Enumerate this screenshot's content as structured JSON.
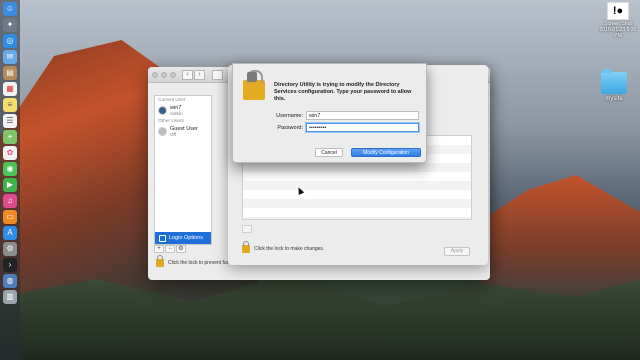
{
  "desktop": {
    "screenshot_label_1": "Screen Shot",
    "screenshot_label_2": "2018-01-23 6:30 PM",
    "folder_label": "mysite"
  },
  "dock": {
    "icons": [
      "finder-icon",
      "launchpad-icon",
      "safari-icon",
      "mail-icon",
      "contacts-icon",
      "calendar-icon",
      "notes-icon",
      "reminders-icon",
      "maps-icon",
      "photos-icon",
      "messages-icon",
      "facetime-icon",
      "itunes-icon",
      "ibooks-icon",
      "app-store-icon",
      "system-preferences-icon",
      "terminal-icon",
      "network-icon",
      "trash-icon"
    ]
  },
  "users_window": {
    "current_user_header": "Current User",
    "current_user_name": "win7",
    "current_user_role": "Admin",
    "other_users_header": "Other Users",
    "guest_name": "Guest User",
    "guest_role": "Off",
    "login_options": "Login Options",
    "add_label": "+",
    "remove_label": "−",
    "lock_text": "Click the lock to prevent further changes."
  },
  "directory_utility": {
    "lock_text": "Click the lock to make changes.",
    "apply_label": "Apply"
  },
  "auth_sheet": {
    "message": "Directory Utility is trying to modify the Directory Services configuration. Type your password to allow this.",
    "username_label": "Username:",
    "username_value": "win7",
    "password_label": "Password:",
    "password_value": "•••••••••",
    "cancel_label": "Cancel",
    "modify_label": "Modify Configuration"
  }
}
